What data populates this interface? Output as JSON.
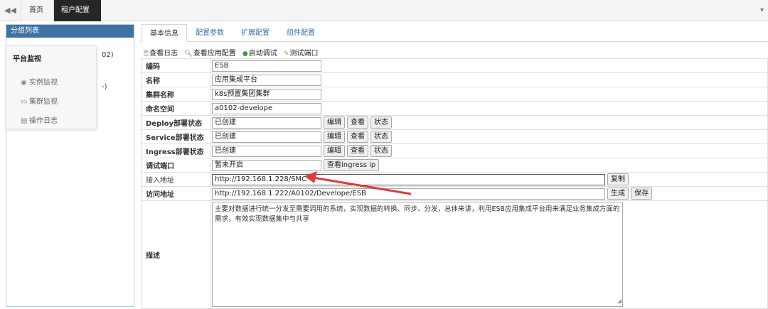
{
  "topbar": {
    "back_icon": "double-left-arrow-icon",
    "tabs": [
      {
        "label": "首页"
      },
      {
        "label": "租户配置",
        "close": "×"
      }
    ]
  },
  "sidebar": {
    "title": "分组列表",
    "partial_texts": [
      "02)",
      "-)"
    ]
  },
  "popup_menu": {
    "title": "平台监视",
    "items": [
      {
        "label": "实例监视",
        "icon": "eye-icon"
      },
      {
        "label": "集群监视",
        "icon": "monitor-icon"
      },
      {
        "label": "操作日志",
        "icon": "document-icon"
      }
    ]
  },
  "main": {
    "tabs": [
      {
        "label": "基本信息",
        "active": true
      },
      {
        "label": "配置参数"
      },
      {
        "label": "扩展配置"
      },
      {
        "label": "组件配置"
      }
    ],
    "toolbar": [
      {
        "label": "查看日志",
        "icon": "list-icon"
      },
      {
        "label": "查看应用配置",
        "icon": "search-icon"
      },
      {
        "label": "启动调试",
        "icon": "play-icon"
      },
      {
        "label": "测试端口",
        "icon": "wrench-icon"
      }
    ],
    "form": {
      "code": {
        "label": "编码",
        "value": "ESB"
      },
      "name": {
        "label": "名称",
        "value": "应用集成平台"
      },
      "cluster": {
        "label": "集群名称",
        "value": "k8s预置集团集群"
      },
      "namespace": {
        "label": "命名空间",
        "value": "a0102-develope"
      },
      "deploy": {
        "label": "Deploy部署状态",
        "value": "已创建"
      },
      "service": {
        "label": "Service部署状态",
        "value": "已创建"
      },
      "ingress": {
        "label": "Ingress部署状态",
        "value": "已创建"
      },
      "debug_port": {
        "label": "调试端口",
        "value": "暂未开启",
        "button": "查看ingress ip"
      },
      "access_url": {
        "label": "接入地址",
        "value": "http://192.168.1.228/SMC",
        "button": "复制"
      },
      "visit_url": {
        "label": "访问地址",
        "value": "http://192.168.1.222/A0102/Develope/ESB",
        "btn_generate": "生成",
        "btn_save": "保存"
      },
      "description": {
        "label": "描述",
        "value": "主要对数据进行统一分发至需要调用的系统，实现数据的转换、同步、分发，总体来讲，利用ESB应用集成平台用来满足业务集成方面的需求，有效实现数据集中与共享"
      }
    },
    "row_buttons": {
      "edit": "编辑",
      "view": "查看",
      "status": "状态"
    }
  },
  "colors": {
    "arrow": "#e03a3a",
    "sidebar_header": "#3f73a6",
    "active_tab": "#262626"
  }
}
